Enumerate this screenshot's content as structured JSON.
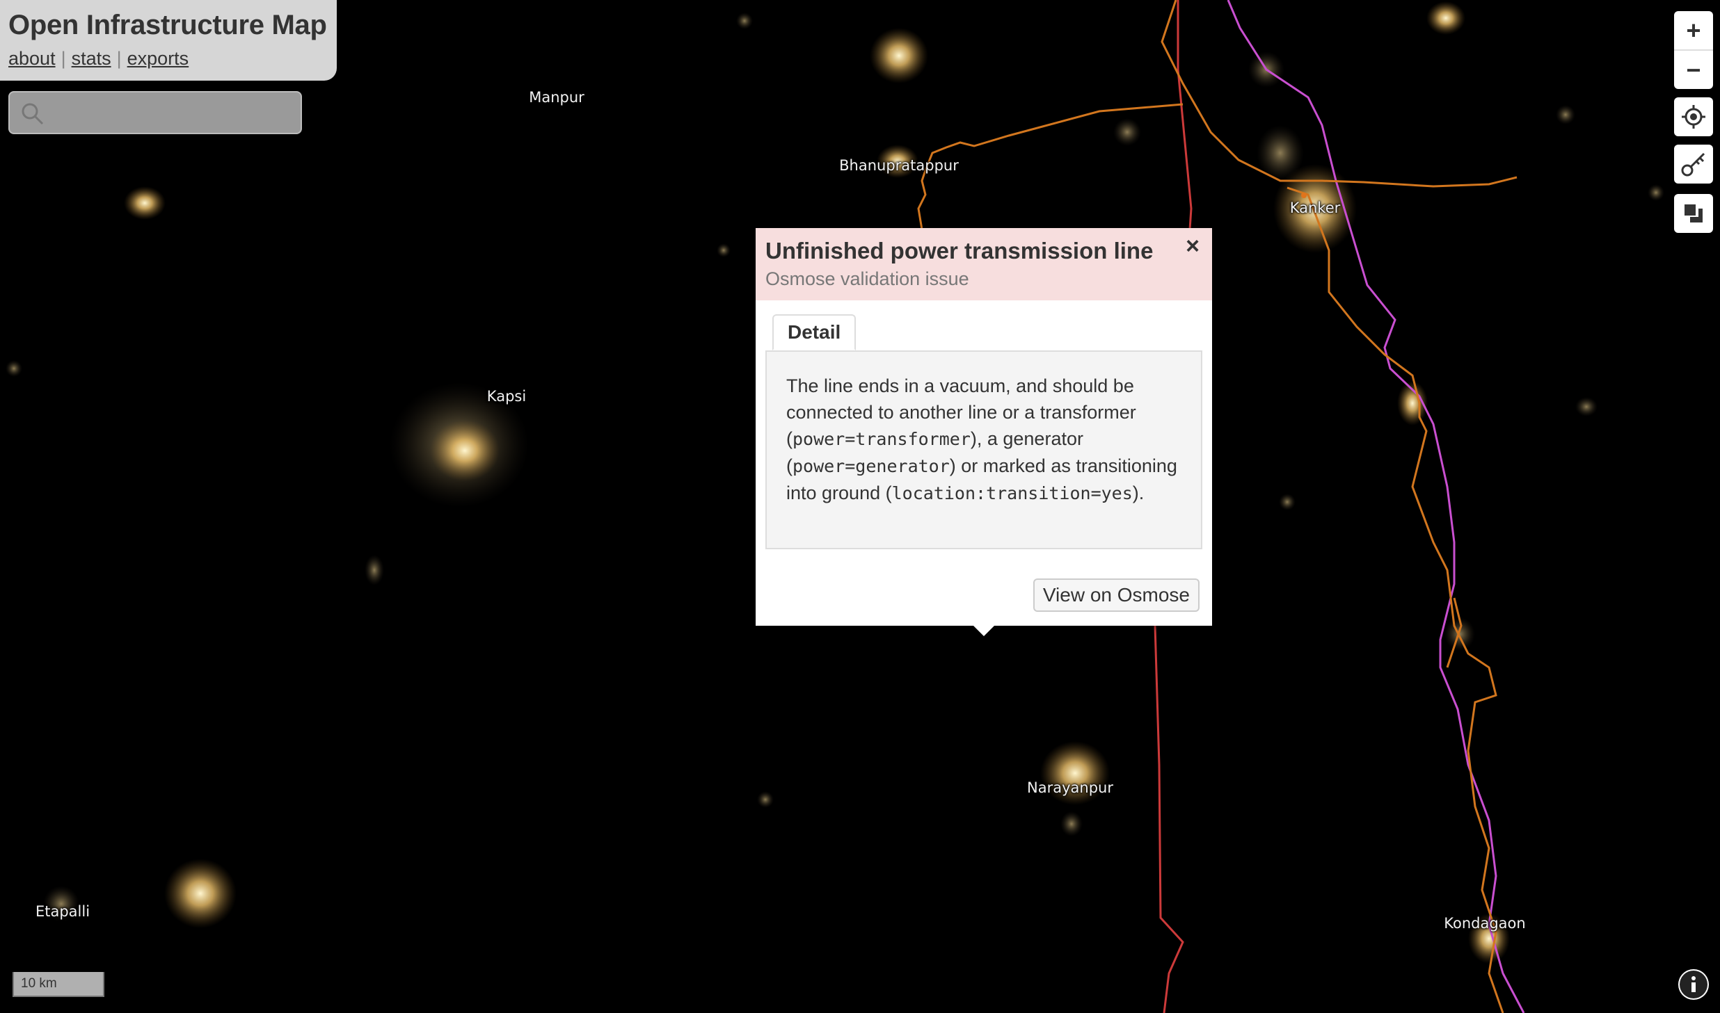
{
  "header": {
    "title": "Open Infrastructure Map",
    "links": [
      {
        "label": "about"
      },
      {
        "label": "stats"
      },
      {
        "label": "exports"
      }
    ]
  },
  "search": {
    "placeholder": "",
    "value": ""
  },
  "map": {
    "places": [
      {
        "name": "Manpur"
      },
      {
        "name": "Bhanupratappur"
      },
      {
        "name": "Kanker"
      },
      {
        "name": "Kapsi"
      },
      {
        "name": "Narayanpur"
      },
      {
        "name": "Etapalli"
      },
      {
        "name": "Kondagaon"
      }
    ],
    "line_colors": {
      "orange": "#d2761e",
      "red": "#cc3a3a",
      "magenta": "#c94fd0"
    },
    "scale_label": "10 km"
  },
  "controls": {
    "zoom_in": "+",
    "zoom_out": "−"
  },
  "popup": {
    "title": "Unfinished power transmission line",
    "subtitle": "Osmose validation issue",
    "close_label": "×",
    "tab_label": "Detail",
    "detail": {
      "text1": "The line ends in a vacuum, and should be connected to another line or a transformer (",
      "code1": "power=transformer",
      "text2": "), a generator (",
      "code2": "power=generator",
      "text3": ") or marked as transitioning into ground (",
      "code3": "location:transition=yes",
      "text4": ")."
    },
    "action_label": "View on Osmose"
  }
}
